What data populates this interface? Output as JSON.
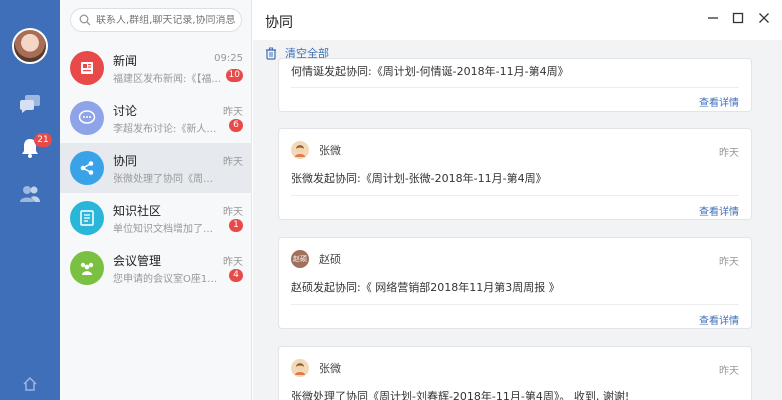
{
  "search": {
    "placeholder": "联系人,群组,聊天记录,协同消息"
  },
  "rail": {
    "notification_badge": "21"
  },
  "conversations": [
    {
      "title": "新闻",
      "time": "09:25",
      "preview": "福建区发布新闻:《【福...",
      "badge": "10",
      "color": "#e84a4a",
      "icon": "news-icon"
    },
    {
      "title": "讨论",
      "time": "昨天",
      "preview": "李超发布讨论:《新人报...",
      "badge": "6",
      "color": "#8fa4e8",
      "icon": "chat-bubble-icon"
    },
    {
      "title": "协同",
      "time": "昨天",
      "preview": "张微处理了协同《周计...",
      "badge": "",
      "color": "#3aa3e8",
      "icon": "share-nodes-icon"
    },
    {
      "title": "知识社区",
      "time": "昨天",
      "preview": "单位知识文档增加了文...",
      "badge": "1",
      "color": "#29b6d9",
      "icon": "document-icon"
    },
    {
      "title": "会议管理",
      "time": "昨天",
      "preview": "您申请的会议室O座101...",
      "badge": "4",
      "color": "#7ac142",
      "icon": "meeting-icon"
    }
  ],
  "main": {
    "title": "协同",
    "clear_all": "清空全部",
    "view_details": "查看详情",
    "cards": [
      {
        "user": "",
        "time": "",
        "text": "何情诞发起协同:《周计划-何情诞-2018年-11月-第4周》"
      },
      {
        "user": "张微",
        "time": "昨天",
        "text": "张微发起协同:《周计划-张微-2018年-11月-第4周》"
      },
      {
        "user": "赵硕",
        "avatar_text": "赵硕",
        "time": "昨天",
        "text": "赵硕发起协同:《 网络营销部2018年11月第3周周报 》"
      },
      {
        "user": "张微",
        "time": "昨天",
        "text": "张微处理了协同《周计划-刘春辉-2018年-11月-第4周》。 收到, 谢谢!"
      }
    ]
  }
}
